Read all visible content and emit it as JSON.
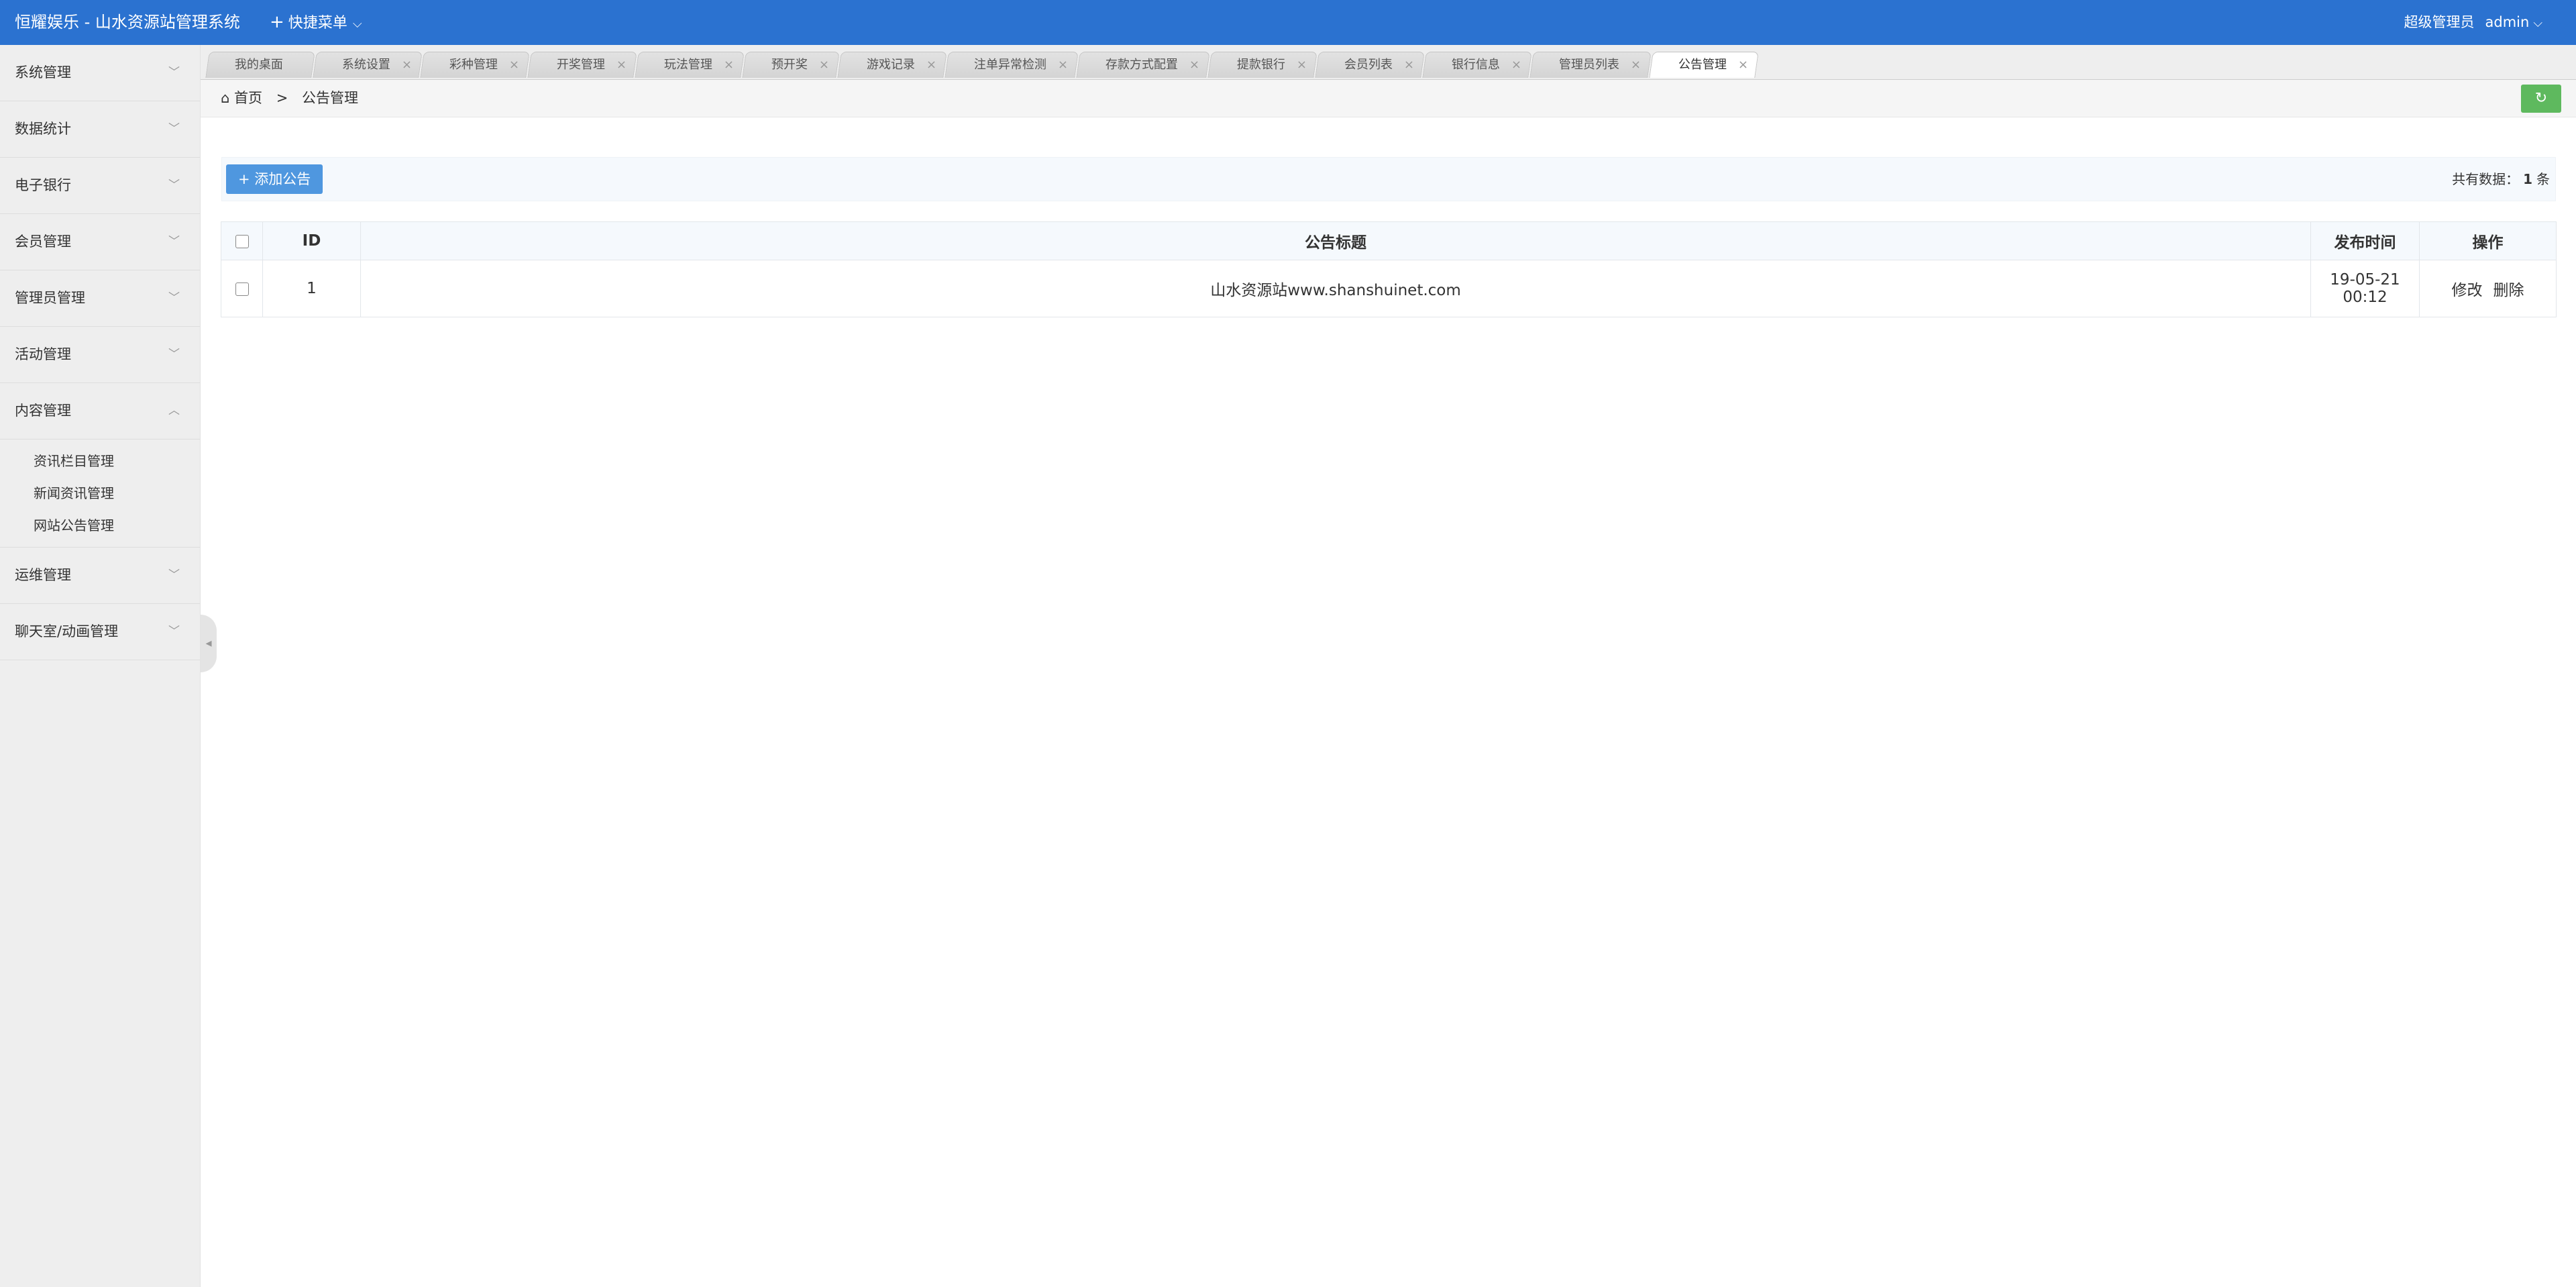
{
  "header": {
    "title": "恒耀娱乐 - 山水资源站管理系统",
    "quick_menu": "快捷菜单",
    "role": "超级管理员",
    "user": "admin"
  },
  "sidebar": {
    "items": [
      {
        "label": "系统管理"
      },
      {
        "label": "数据统计"
      },
      {
        "label": "电子银行"
      },
      {
        "label": "会员管理"
      },
      {
        "label": "管理员管理"
      },
      {
        "label": "活动管理"
      },
      {
        "label": "内容管理",
        "expanded": true,
        "children": [
          "资讯栏目管理",
          "新闻资讯管理",
          "网站公告管理"
        ]
      },
      {
        "label": "运维管理"
      },
      {
        "label": "聊天室/动画管理"
      }
    ]
  },
  "tabs": [
    {
      "label": "我的桌面",
      "closable": false
    },
    {
      "label": "系统设置",
      "closable": true
    },
    {
      "label": "彩种管理",
      "closable": true
    },
    {
      "label": "开奖管理",
      "closable": true
    },
    {
      "label": "玩法管理",
      "closable": true
    },
    {
      "label": "预开奖",
      "closable": true
    },
    {
      "label": "游戏记录",
      "closable": true
    },
    {
      "label": "注单异常检测",
      "closable": true
    },
    {
      "label": "存款方式配置",
      "closable": true
    },
    {
      "label": "提款银行",
      "closable": true
    },
    {
      "label": "会员列表",
      "closable": true
    },
    {
      "label": "银行信息",
      "closable": true
    },
    {
      "label": "管理员列表",
      "closable": true
    },
    {
      "label": "公告管理",
      "closable": true,
      "active": true
    }
  ],
  "breadcrumb": {
    "home": "首页",
    "separator": ">",
    "current": "公告管理"
  },
  "toolbar": {
    "add_label": "添加公告",
    "count_prefix": "共有数据：",
    "count": "1",
    "count_suffix": "条"
  },
  "table": {
    "headers": {
      "id": "ID",
      "title": "公告标题",
      "time": "发布时间",
      "ops": "操作"
    },
    "rows": [
      {
        "id": "1",
        "title": "山水资源站www.shanshuinet.com",
        "time": "19-05-21 00:12",
        "edit": "修改",
        "delete": "删除"
      }
    ]
  },
  "colors": {
    "header_bg": "#2b72d0",
    "primary_button": "#4f97df",
    "refresh_button": "#5eb95e"
  }
}
